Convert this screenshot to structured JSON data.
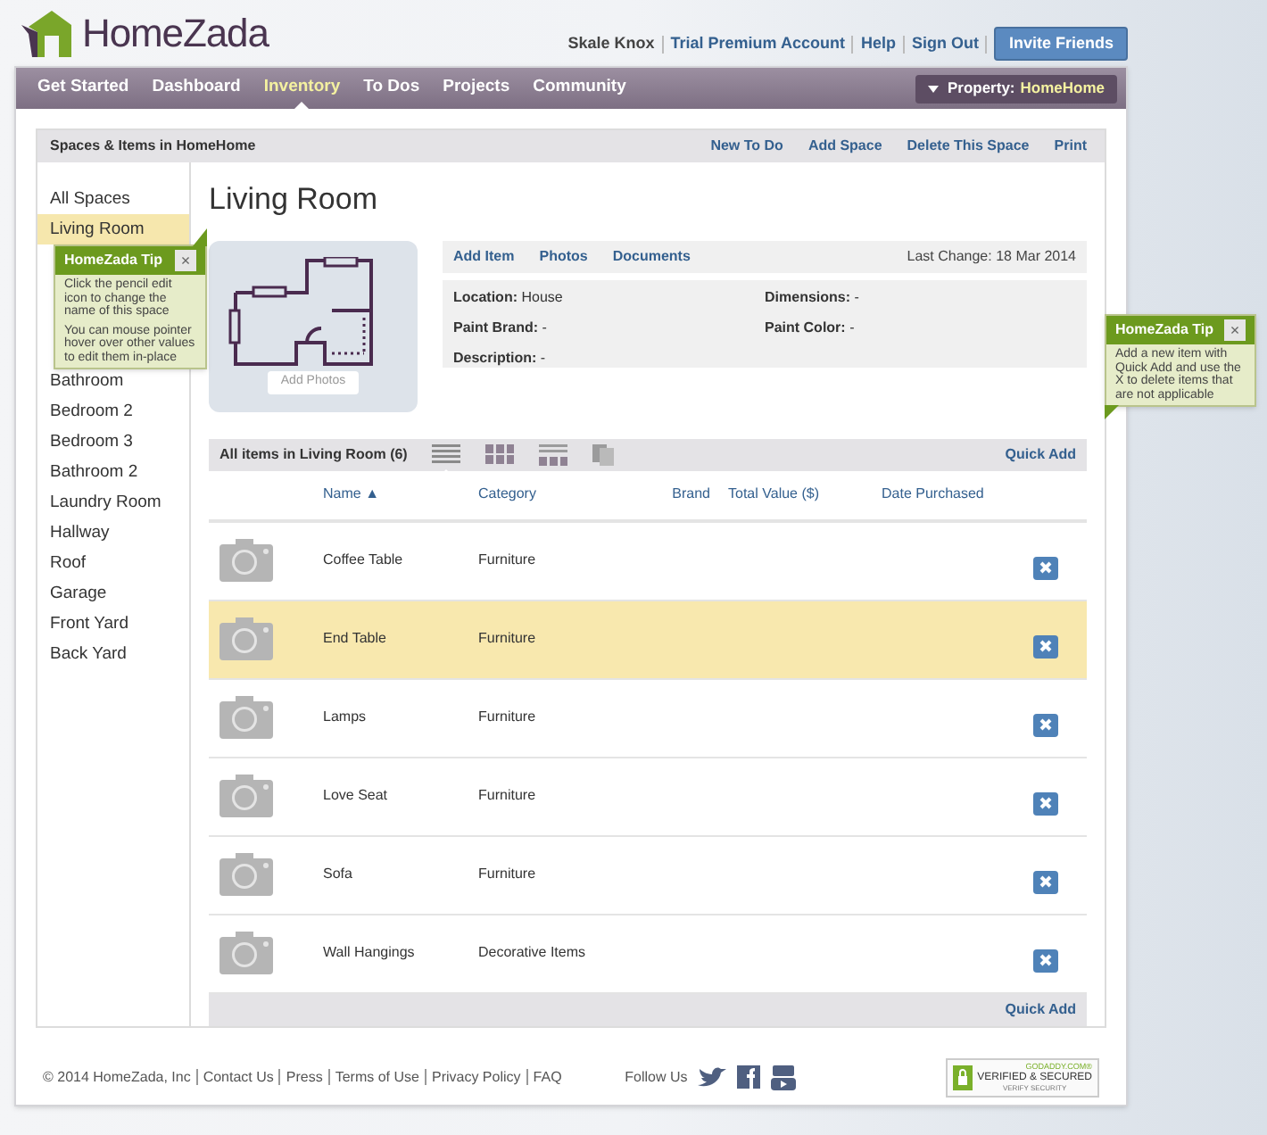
{
  "header": {
    "logo": "HomeZada",
    "user_links": [
      "Skale Knox",
      "Trial Premium Account",
      "Help",
      "Sign Out"
    ],
    "invite_button": "Invite Friends"
  },
  "nav": {
    "items": [
      {
        "label": "Get Started",
        "selected": false
      },
      {
        "label": "Dashboard",
        "selected": false
      },
      {
        "label": "Inventory",
        "selected": true
      },
      {
        "label": "To Dos",
        "selected": false
      },
      {
        "label": "Projects",
        "selected": false
      },
      {
        "label": "Community",
        "selected": false
      }
    ],
    "property_label": "Property:",
    "property_value": "HomeHome"
  },
  "panel": {
    "title": "Spaces & Items in HomeHome",
    "actions": [
      "New To Do",
      "Add Space",
      "Delete This Space",
      "Print"
    ]
  },
  "sidebar": {
    "items": [
      {
        "label": "All Spaces",
        "selected": false
      },
      {
        "label": "Living Room",
        "selected": true
      },
      {
        "label": "Bathroom",
        "selected": false
      },
      {
        "label": "Bedroom 2",
        "selected": false
      },
      {
        "label": "Bedroom 3",
        "selected": false
      },
      {
        "label": "Bathroom 2",
        "selected": false
      },
      {
        "label": "Laundry Room",
        "selected": false
      },
      {
        "label": "Hallway",
        "selected": false
      },
      {
        "label": "Roof",
        "selected": false
      },
      {
        "label": "Garage",
        "selected": false
      },
      {
        "label": "Front Yard",
        "selected": false
      },
      {
        "label": "Back Yard",
        "selected": false
      }
    ]
  },
  "space": {
    "title": "Living Room",
    "add_photos": "Add Photos",
    "tabs": [
      "Add Item",
      "Photos",
      "Documents"
    ],
    "last_change": "Last Change: 18 Mar 2014",
    "fields_left": [
      "**Location:** House",
      "**Paint Brand:** -",
      "**Description:** -"
    ],
    "fields_right": [
      "**Dimensions:** -",
      "**Paint Color:** -"
    ]
  },
  "items_bar": {
    "title": "All items in Living Room (6)",
    "views": [
      {
        "kind": "list",
        "selected": true
      },
      {
        "kind": "grid",
        "selected": false
      },
      {
        "kind": "rows",
        "selected": false
      },
      {
        "kind": "cards",
        "selected": false
      }
    ],
    "quick_add": "Quick Add"
  },
  "table": {
    "columns": [
      "Name ▲",
      "Category",
      "Brand",
      "Total Value ($)",
      "Date Purchased"
    ],
    "rows": [
      {
        "name": "Coffee Table",
        "category": "Furniture",
        "selected": false
      },
      {
        "name": "End Table",
        "category": "Furniture",
        "selected": true
      },
      {
        "name": "Lamps",
        "category": "Furniture",
        "selected": false
      },
      {
        "name": "Love Seat",
        "category": "Furniture",
        "selected": false
      },
      {
        "name": "Sofa",
        "category": "Furniture",
        "selected": false
      },
      {
        "name": "Wall Hangings",
        "category": "Decorative Items",
        "selected": false
      }
    ],
    "quick_add": "Quick Add"
  },
  "tips": [
    {
      "title": "HomeZada Tip",
      "close": "×",
      "paragraphs": [
        "Click the pencil edit icon to change the name of this space",
        "You can mouse pointer hover over other values to edit them in-place"
      ]
    },
    {
      "title": "HomeZada Tip",
      "close": "×",
      "paragraphs": [
        "Add a new item with Quick Add and use the X to delete items that are not applicable"
      ]
    }
  ],
  "footer": {
    "copyright": "© 2014 HomeZada, Inc",
    "links": [
      "Contact Us",
      "Press",
      "Terms of Use",
      "Privacy Policy",
      "FAQ"
    ],
    "follow": "Follow Us",
    "badge_top": "GODADDY.COM®",
    "badge_main": "VERIFIED & SECURED",
    "badge_bottom": "VERIFY SECURITY"
  }
}
